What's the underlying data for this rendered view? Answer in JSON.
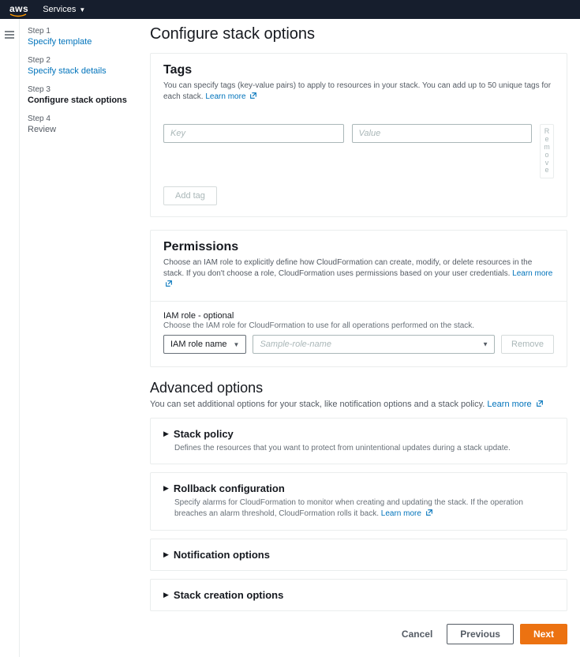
{
  "topnav": {
    "brand": "aws",
    "services": "Services"
  },
  "steps": [
    {
      "label": "Step 1",
      "name": "Specify template",
      "state": "link"
    },
    {
      "label": "Step 2",
      "name": "Specify stack details",
      "state": "link"
    },
    {
      "label": "Step 3",
      "name": "Configure stack options",
      "state": "active"
    },
    {
      "label": "Step 4",
      "name": "Review",
      "state": "muted"
    }
  ],
  "page_title": "Configure stack options",
  "tags": {
    "heading": "Tags",
    "desc": "You can specify tags (key-value pairs) to apply to resources in your stack. You can add up to 50 unique tags for each stack.",
    "learn_more": "Learn more",
    "key_placeholder": "Key",
    "value_placeholder": "Value",
    "remove_letters": [
      "R",
      "e",
      "m",
      "o",
      "v",
      "e"
    ],
    "add_tag": "Add tag"
  },
  "permissions": {
    "heading": "Permissions",
    "desc": "Choose an IAM role to explicitly define how CloudFormation can create, modify, or delete resources in the stack. If you don't choose a role, CloudFormation uses permissions based on your user credentials.",
    "learn_more": "Learn more",
    "iam_role_label": "IAM role - optional",
    "iam_role_sub": "Choose the IAM role for CloudFormation to use for all operations performed on the stack.",
    "select_value": "IAM role name",
    "role_placeholder": "Sample-role-name",
    "remove": "Remove"
  },
  "advanced": {
    "heading": "Advanced options",
    "desc": "You can set additional options for your stack, like notification options and a stack policy.",
    "learn_more": "Learn more",
    "panels": [
      {
        "title": "Stack policy",
        "desc": "Defines the resources that you want to protect from unintentional updates during a stack update."
      },
      {
        "title": "Rollback configuration",
        "desc": "Specify alarms for CloudFormation to monitor when creating and updating the stack. If the operation breaches an alarm threshold, CloudFormation rolls it back.",
        "learn_more": "Learn more"
      },
      {
        "title": "Notification options",
        "desc": ""
      },
      {
        "title": "Stack creation options",
        "desc": ""
      }
    ]
  },
  "footer": {
    "cancel": "Cancel",
    "previous": "Previous",
    "next": "Next"
  }
}
